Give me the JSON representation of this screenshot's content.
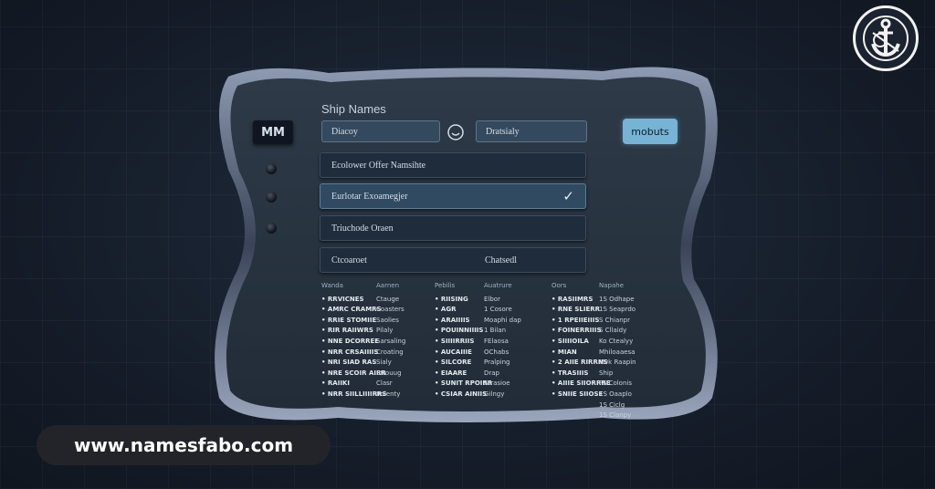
{
  "panel": {
    "title": "Ship Names",
    "left_button": "MM",
    "search_field": "Diacoy",
    "second_field": "Dratsialy",
    "action_button": "mobuts"
  },
  "rows": [
    {
      "label": "Ecolower Offer Namsihte",
      "selected": false
    },
    {
      "label": "Eurlotar Exoamegjer",
      "selected": true
    },
    {
      "label": "Triuchode Oraen",
      "selected": false
    },
    {
      "label": "Ctcoaroet",
      "label2": "Chatsedl",
      "selected": false
    }
  ],
  "table": {
    "columns": [
      {
        "header": "Wanda",
        "bold": true,
        "cells": [
          "RRVICNES",
          "AMRC CRAMRS",
          "RRIE STOMIIE",
          "RIR RAIIWRS",
          "NNE DCORREE",
          "NRR CRSAIIIIS",
          "NRI SIAD RAS",
          "NRE SCOIR AIRR",
          "RAIIKI",
          "NRR SIILLIIIIRRS"
        ]
      },
      {
        "header": "Aarnen",
        "bold": false,
        "cells": [
          "Ctauge",
          "Coasters",
          "Saolies",
          "Pilaly",
          "Sarsaling",
          "Croating",
          "Sialy",
          "Strouug",
          "Clasr",
          "Rolenty"
        ]
      },
      {
        "header": "Pebilis",
        "bold": true,
        "cells": [
          "RIISING",
          "AGR",
          "ARAIIIIS",
          "POUINNIIIIS",
          "SIIIIRRIIS",
          "AUCAIIIE",
          "SILCORE",
          "EIAARE",
          "SUNIT RPOIRR",
          "CSIAR AINIIS"
        ]
      },
      {
        "header": "Auatrure",
        "bold": false,
        "cells": [
          "Elbor",
          "1 Cosore",
          "Moaphi dap",
          "1 Bilan",
          "FElaosa",
          "OChabs",
          "Pralping",
          "Drap",
          "Strasioe",
          "Gilngy"
        ]
      },
      {
        "header": "Oors",
        "bold": true,
        "cells": [
          "RASIIMRS",
          "RNE SLIERR",
          "1 RPEIIEIIIS",
          "FOINERRIIIS",
          "SIIIIOILA",
          "MIAN",
          "2 AIIE RIRRNS",
          "TRASIIIS",
          "AIIIE SIIORRRE",
          "SNIIE SIIOSE"
        ]
      },
      {
        "header": "Napahe",
        "bold": false,
        "cells": [
          "1S Odhape",
          "1S Seaprdo",
          "S Chianpr",
          "S Cllaidy",
          "Ko Ctealyy",
          "Mhiloaaesa",
          "Mvk Raapin Ship",
          "FS Colonis",
          "1S Oaaplo",
          "1S Ciclg",
          "1S Clanpy"
        ]
      }
    ]
  },
  "footer": {
    "url": "www.namesfabo.com"
  },
  "colors": {
    "accent": "#76b3d5",
    "background": "#151d2a",
    "panel": "#27323f"
  }
}
